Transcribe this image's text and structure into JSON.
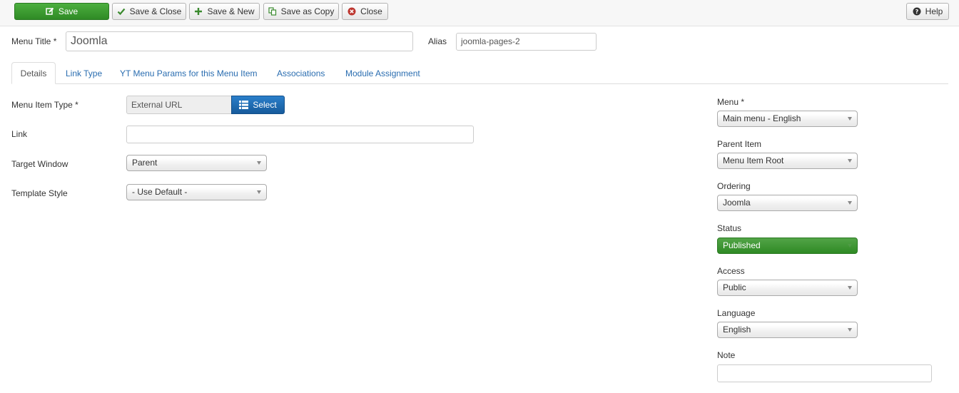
{
  "toolbar": {
    "save": "Save",
    "save_close": "Save & Close",
    "save_new": "Save & New",
    "save_copy": "Save as Copy",
    "close": "Close",
    "help": "Help"
  },
  "header": {
    "menu_title_label": "Menu Title *",
    "menu_title_value": "Joomla",
    "alias_label": "Alias",
    "alias_value": "joomla-pages-2"
  },
  "tabs": [
    {
      "label": "Details",
      "active": true
    },
    {
      "label": "Link Type"
    },
    {
      "label": "YT Menu Params for this Menu Item"
    },
    {
      "label": "Associations"
    },
    {
      "label": "Module Assignment"
    }
  ],
  "details": {
    "menu_item_type_label": "Menu Item Type *",
    "menu_item_type_value": "External URL",
    "select_button": "Select",
    "link_label": "Link",
    "link_value": "",
    "target_window_label": "Target Window",
    "target_window_value": "Parent",
    "template_style_label": "Template Style",
    "template_style_value": "- Use Default -"
  },
  "sidebar": {
    "menu_label": "Menu *",
    "menu_value": "Main menu - English",
    "parent_item_label": "Parent Item",
    "parent_item_value": "Menu Item Root",
    "ordering_label": "Ordering",
    "ordering_value": "Joomla",
    "status_label": "Status",
    "status_value": "Published",
    "access_label": "Access",
    "access_value": "Public",
    "language_label": "Language",
    "language_value": "English",
    "note_label": "Note",
    "note_value": ""
  },
  "colors": {
    "primary_green": "#2f8a25",
    "select_blue": "#1d6fb8",
    "link_blue": "#2a6db0"
  },
  "icons": {
    "save": "edit-icon",
    "save_close": "check-icon",
    "save_new": "plus-icon",
    "save_copy": "copy-icon",
    "close": "close-circle-icon",
    "help": "question-circle-icon",
    "select": "list-icon"
  }
}
